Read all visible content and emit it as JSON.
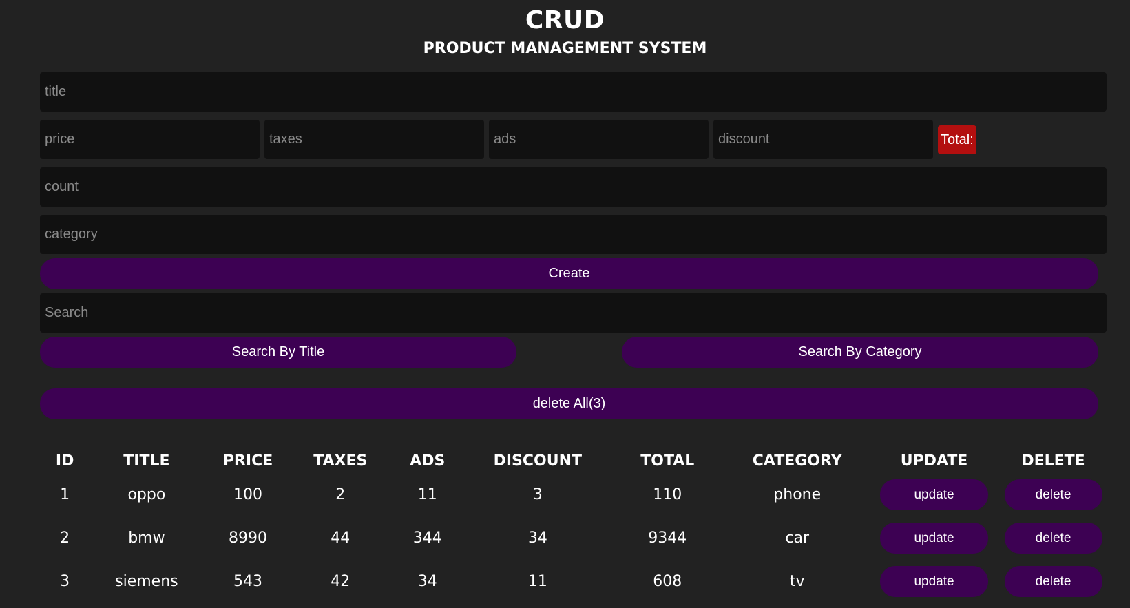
{
  "header": {
    "title": "CRUD",
    "subtitle": "PRODUCT MANAGEMENT SYSTEM"
  },
  "form": {
    "title_placeholder": "title",
    "price_placeholder": "price",
    "taxes_placeholder": "taxes",
    "ads_placeholder": "ads",
    "discount_placeholder": "discount",
    "total_label": "Total:",
    "count_placeholder": "count",
    "category_placeholder": "category",
    "create_label": "Create"
  },
  "search": {
    "placeholder": "Search",
    "by_title_label": "Search By Title",
    "by_category_label": "Search By Category"
  },
  "delete_all_label": "delete All(3)",
  "table": {
    "headers": [
      "ID",
      "TITLE",
      "PRICE",
      "TAXES",
      "ADS",
      "DISCOUNT",
      "TOTAL",
      "CATEGORY",
      "UPDATE",
      "DELETE"
    ],
    "rows": [
      {
        "id": "1",
        "title": "oppo",
        "price": "100",
        "taxes": "2",
        "ads": "11",
        "discount": "3",
        "total": "110",
        "category": "phone",
        "update": "update",
        "delete": "delete"
      },
      {
        "id": "2",
        "title": "bmw",
        "price": "8990",
        "taxes": "44",
        "ads": "344",
        "discount": "34",
        "total": "9344",
        "category": "car",
        "update": "update",
        "delete": "delete"
      },
      {
        "id": "3",
        "title": "siemens",
        "price": "543",
        "taxes": "42",
        "ads": "34",
        "discount": "11",
        "total": "608",
        "category": "tv",
        "update": "update",
        "delete": "delete"
      }
    ]
  },
  "colors": {
    "background": "#222222",
    "input_background": "#111111",
    "button_purple": "#3d0153",
    "total_red": "#b30f0f"
  }
}
